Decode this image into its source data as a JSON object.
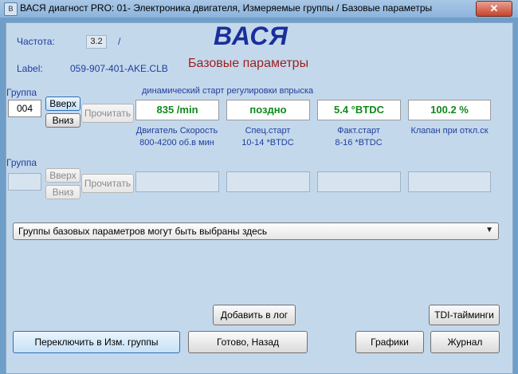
{
  "window": {
    "title": "ВАСЯ диагност PRO: 01- Электроника двигателя,  Измеряемые группы / Базовые параметры",
    "close_glyph": "✕",
    "app_icon_glyph": "В"
  },
  "header": {
    "freq_label": "Частота:",
    "freq_value": "3.2",
    "freq_unit": "/",
    "label_label": "Label:",
    "label_value": "059-907-401-AKE.CLB",
    "brand": "ВАСЯ",
    "subtitle": "Базовые параметры"
  },
  "group1": {
    "group_label": "Группа",
    "group_value": "004",
    "up_label": "Вверх",
    "down_label": "Вниз",
    "read_label": "Прочитать",
    "caption": "динамический старт регулировки впрыска",
    "fields": [
      {
        "value": "835 /min",
        "desc1": "Двигатель Скорость",
        "desc2": "800-4200 об.в мин"
      },
      {
        "value": "поздно",
        "desc1": "Спец.старт",
        "desc2": "10-14 *BTDC"
      },
      {
        "value": "5.4 °BTDC",
        "desc1": "Факт.старт",
        "desc2": "8-16 *BTDC"
      },
      {
        "value": "100.2 %",
        "desc1": "Клапан при откл.ск",
        "desc2": ""
      }
    ]
  },
  "group2": {
    "group_label": "Группа",
    "group_value": "",
    "up_label": "Вверх",
    "down_label": "Вниз",
    "read_label": "Прочитать"
  },
  "dropdown": {
    "selected": "Группы базовых параметров могут быть выбраны здесь"
  },
  "buttons": {
    "add_log": "Добавить в лог",
    "tdi": "TDI-тайминги",
    "switch": "Переключить в Изм. группы",
    "done_back": "Готово, Назад",
    "graphs": "Графики",
    "journal": "Журнал"
  }
}
